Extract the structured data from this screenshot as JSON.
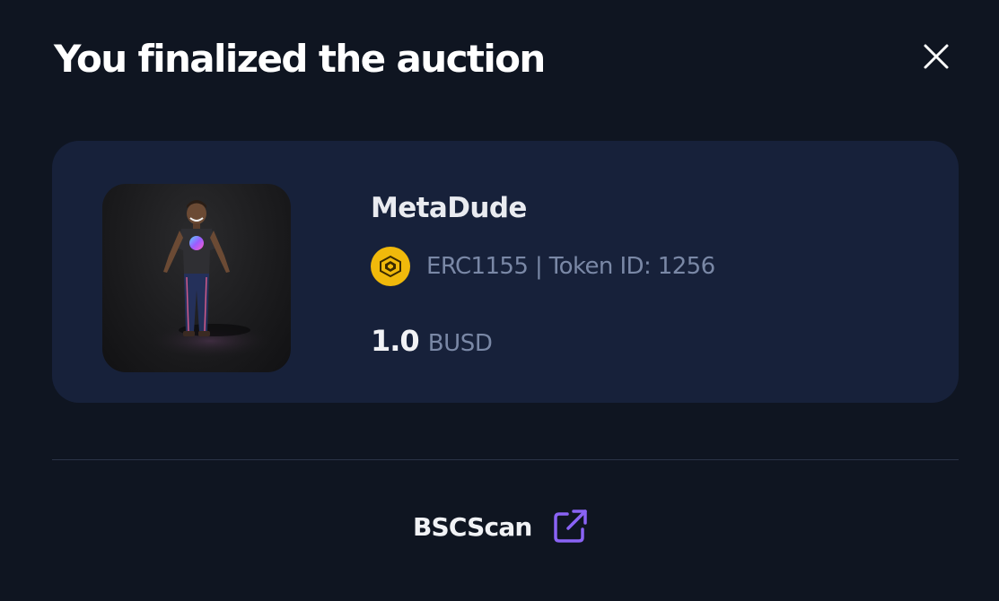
{
  "modal": {
    "title": "You finalized the auction",
    "close_icon": "close-icon"
  },
  "nft": {
    "name": "MetaDude",
    "chain_icon": "bnb-chain-icon",
    "standard_and_token": "ERC1155 | Token ID: 1256",
    "price_value": "1.0",
    "price_unit": "BUSD",
    "image_alt": "MetaDude avatar"
  },
  "footer": {
    "link_label": "BSCScan",
    "link_icon": "external-link-icon"
  },
  "colors": {
    "background": "#0f1521",
    "card": "#17213a",
    "chain_icon": "#f0b90b",
    "link_icon": "#8a63f5",
    "muted_text": "#7a88a6"
  }
}
